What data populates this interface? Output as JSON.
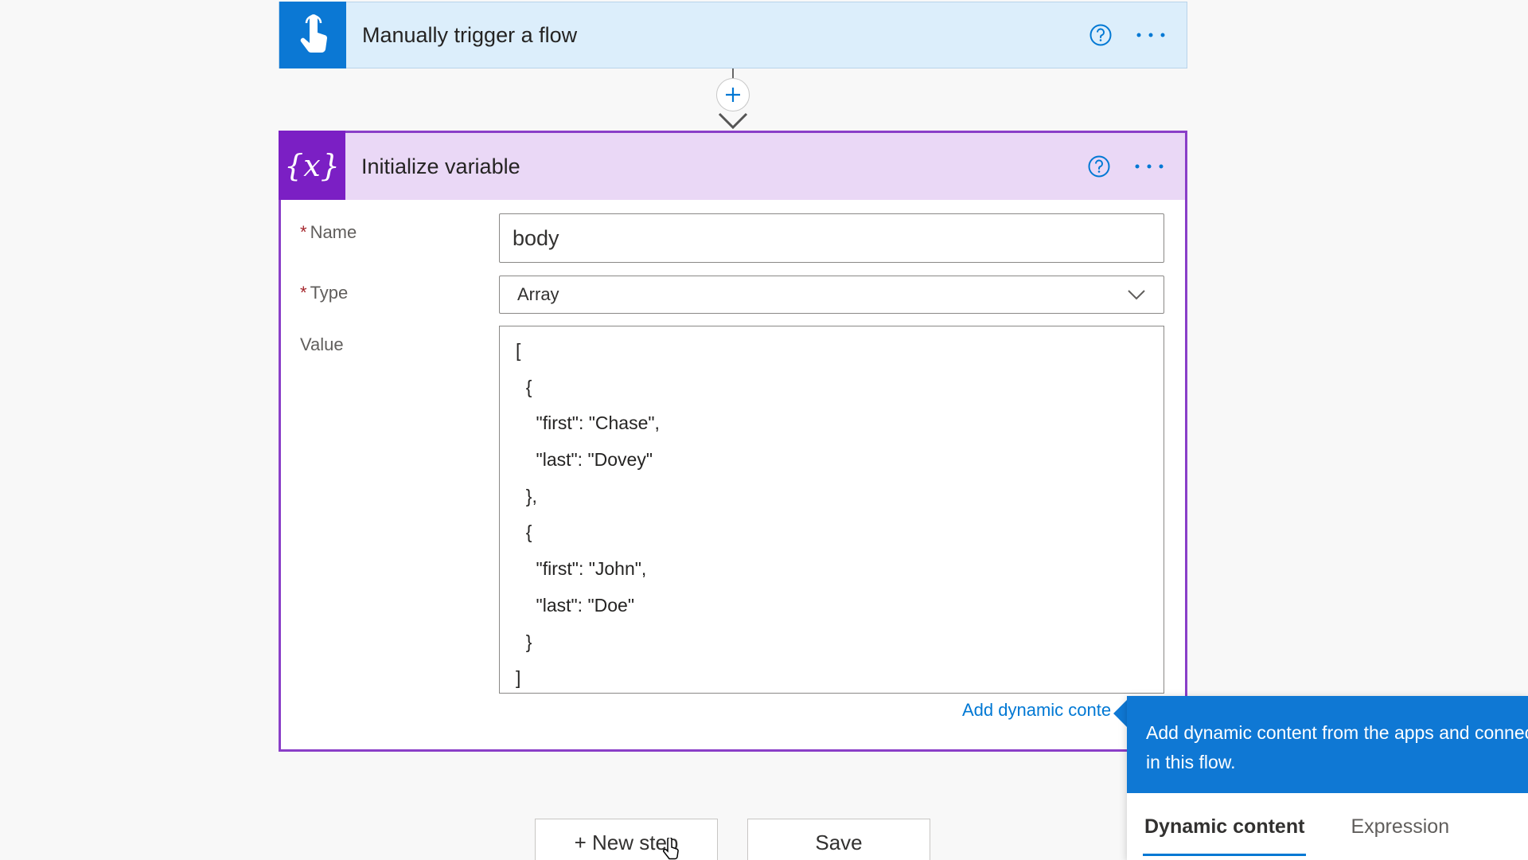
{
  "trigger": {
    "title": "Manually trigger a flow",
    "icon": "hand-touch-icon",
    "accent": "#0b78d4"
  },
  "connector": {
    "add_icon": "plus-icon",
    "arrow_icon": "arrow-down-icon"
  },
  "init_variable": {
    "title": "Initialize variable",
    "icon_glyph": "{x}",
    "accent": "#7b1fc4",
    "fields": {
      "name_label": "Name",
      "name_value": "body",
      "type_label": "Type",
      "type_value": "Array",
      "value_label": "Value",
      "value_lines": [
        "[",
        "  {",
        "    \"first\": \"Chase\",",
        "    \"last\": \"Dovey\"",
        "  },",
        "  {",
        "    \"first\": \"John\",",
        "    \"last\": \"Doe\"",
        "  }",
        "]"
      ]
    },
    "add_dynamic_link": "Add dynamic conte"
  },
  "buttons": {
    "new_step": "+ New step",
    "save": "Save"
  },
  "flyout": {
    "description": "Add dynamic content from the apps and connectors used in this flow.",
    "tabs": [
      "Dynamic content",
      "Expression"
    ],
    "active_tab": "Dynamic content",
    "accent": "#0f78d4"
  }
}
